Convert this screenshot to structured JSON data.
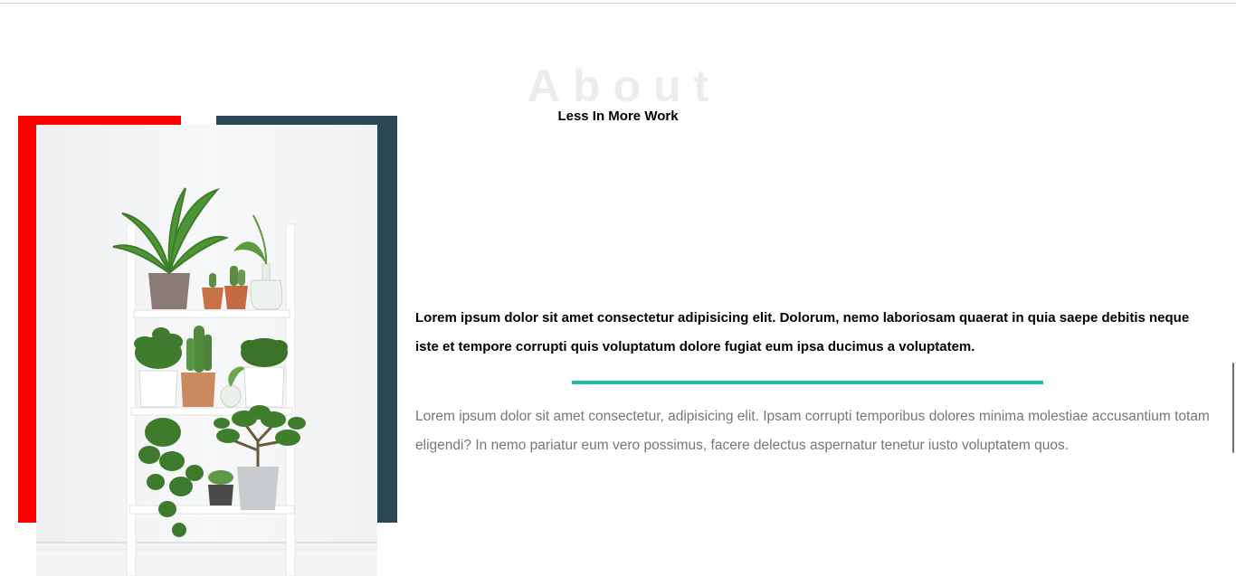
{
  "about": {
    "title": "About",
    "subtitle": "Less In More Work",
    "lead": "Lorem ipsum dolor sit amet consectetur adipisicing elit. Dolorum, nemo laboriosam quaerat in quia saepe debitis neque iste et tempore corrupti quis voluptatum dolore fugiat eum ipsa ducimus a voluptatem.",
    "body": "Lorem ipsum dolor sit amet consectetur, adipisicing elit. Ipsam corrupti temporibus dolores minima molestiae accusantium totam eligendi? In nemo pariatur eum vero possimus, facere delectus aspernatur tenetur iusto voluptatem quos."
  },
  "colors": {
    "red_accent": "#fe0000",
    "navy_accent": "#2b4754",
    "teal_divider": "#1dbfa6",
    "title_watermark": "#ececec",
    "body_text": "#777777"
  },
  "image": {
    "subject": "white ladder shelf with potted plants"
  }
}
